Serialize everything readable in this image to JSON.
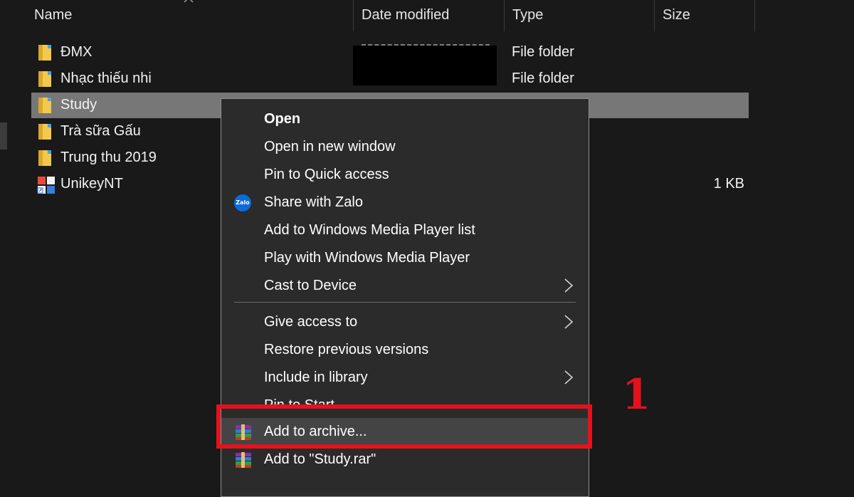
{
  "columns": {
    "name": "Name",
    "date_modified": "Date modified",
    "type": "Type",
    "size": "Size"
  },
  "files": [
    {
      "name": "ĐMX",
      "type": "File folder",
      "size": ""
    },
    {
      "name": "Nhạc thiếu nhi",
      "type": "File folder",
      "size": ""
    },
    {
      "name": "Study",
      "type": "",
      "size": ""
    },
    {
      "name": "Trà sữa Gấu",
      "type": "",
      "size": ""
    },
    {
      "name": "Trung thu 2019",
      "type": "",
      "size": ""
    },
    {
      "name": "UnikeyNT",
      "type": "",
      "size": "1 KB"
    }
  ],
  "context_menu": {
    "items": [
      {
        "label": "Open"
      },
      {
        "label": "Open in new window"
      },
      {
        "label": "Pin to Quick access"
      },
      {
        "label": "Share with Zalo",
        "icon": "zalo-icon",
        "icon_text": "Zalo"
      },
      {
        "label": "Add to Windows Media Player list"
      },
      {
        "label": "Play with Windows Media Player"
      },
      {
        "label": "Cast to Device"
      },
      {
        "label": "Give access to"
      },
      {
        "label": "Restore previous versions"
      },
      {
        "label": "Include in library"
      },
      {
        "label": "Pin to Start"
      },
      {
        "label": "Add to archive..."
      },
      {
        "label": "Add to \"Study.rar\""
      }
    ]
  },
  "annotation": {
    "step_number": "1",
    "color": "#e3121c"
  },
  "colors": {
    "background": "#191919",
    "selection": "#777777",
    "menu_bg": "#2b2b2b",
    "folder": "#f2c94c"
  }
}
